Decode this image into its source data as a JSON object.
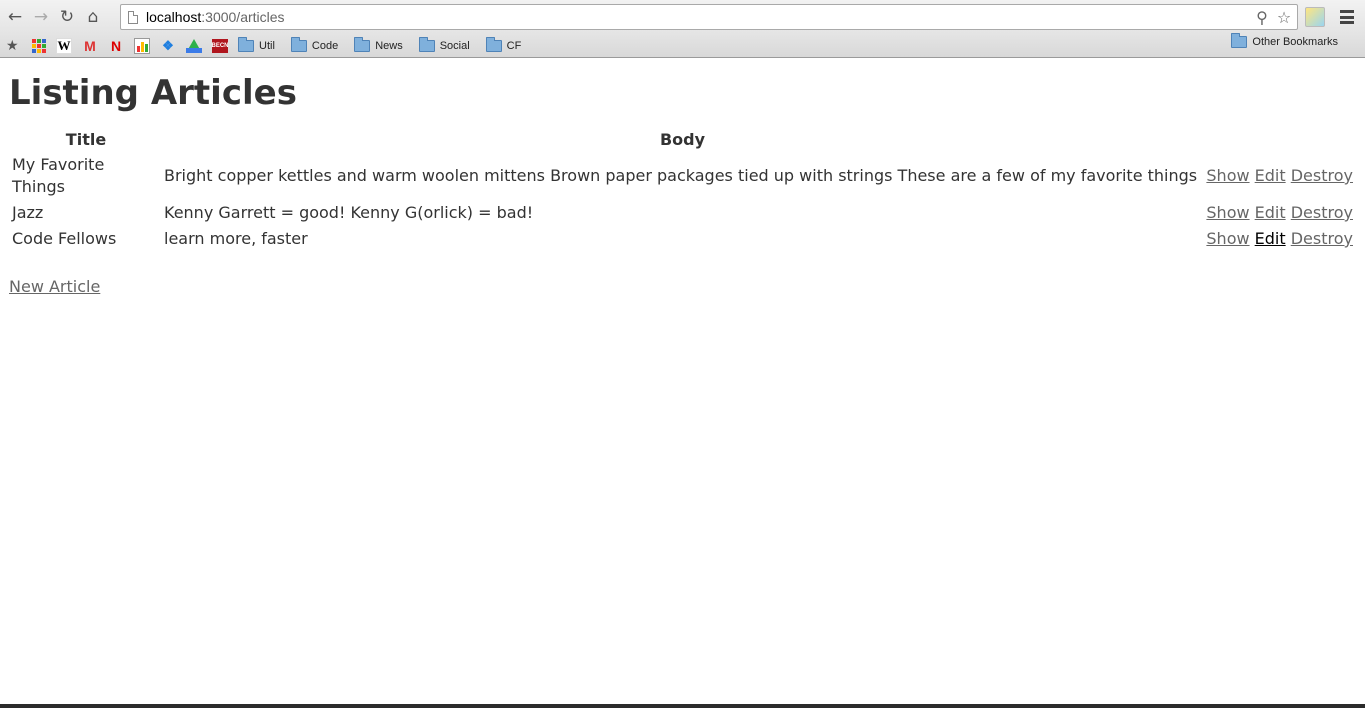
{
  "browser": {
    "url_host": "localhost",
    "url_path": ":3000/articles",
    "bookmarks": [
      {
        "label": "Util"
      },
      {
        "label": "Code"
      },
      {
        "label": "News"
      },
      {
        "label": "Social"
      },
      {
        "label": "CF"
      }
    ],
    "other_bookmarks": "Other Bookmarks",
    "favicons": [
      "apps-icon",
      "wikipedia-icon",
      "gmail-icon",
      "netflix-icon",
      "chart-icon",
      "dropbox-icon",
      "google-drive-icon",
      "tech-icon"
    ],
    "favicon_text": {
      "wiki": "W",
      "gmail": "M",
      "netflix": "N",
      "tech": "BECN"
    }
  },
  "page": {
    "heading": "Listing Articles",
    "columns": {
      "title": "Title",
      "body": "Body"
    },
    "articles": [
      {
        "title": "My Favorite Things",
        "body": "Bright copper kettles and warm woolen mittens Brown paper packages tied up with strings These are a few of my favorite things",
        "show": "Show",
        "edit": "Edit",
        "destroy": "Destroy"
      },
      {
        "title": "Jazz",
        "body": "Kenny Garrett = good! Kenny G(orlick) = bad!",
        "show": "Show",
        "edit": "Edit",
        "destroy": "Destroy"
      },
      {
        "title": "Code Fellows",
        "body": "learn more, faster",
        "show": "Show",
        "edit": "Edit",
        "destroy": "Destroy"
      }
    ],
    "new_article_label": "New Article"
  },
  "colors": {
    "link": "#666666",
    "link_active": "#000000",
    "text": "#333333"
  }
}
